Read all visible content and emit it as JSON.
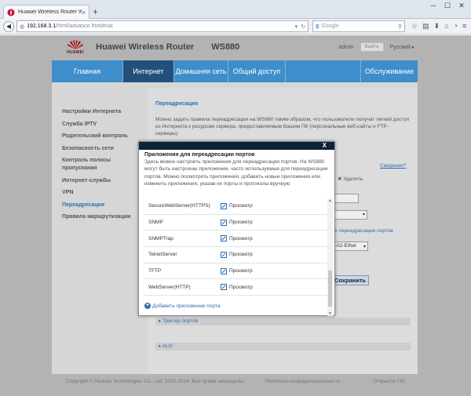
{
  "browser": {
    "tab_title": "Huawei Wireless Router W...",
    "url_host": "192.168.3.1",
    "url_path": "/html/advance.html#nat",
    "search_placeholder": "Google"
  },
  "header": {
    "brand": "Huawei Wireless Router",
    "model": "WS880",
    "logo_text": "HUAWEI",
    "user": "admin",
    "logout": "Выйти",
    "language": "Русский"
  },
  "nav": {
    "items": [
      "Главная",
      "Интернет",
      "Домашняя сеть",
      "Общий доступ",
      "Обслуживание"
    ],
    "active_index": 1
  },
  "sidebar": {
    "items": [
      "Настройки Интернета",
      "Служба IPTV",
      "Родительский контроль",
      "Безопасность сети",
      "Контроль полосы",
      "пропускания",
      "Интернет-службы",
      "VPN",
      "Переадресация",
      "Правила маршрутизации"
    ],
    "active_index": 8
  },
  "page": {
    "title": "Переадресация",
    "description": "Можно задать правила переадресации на WS880 таким образом, что пользователи получат легкий доступ из Интернета к ресурсам сервера, предоставляемым Вашим ПК (персональные веб-сайты и FTP-серверы).",
    "help_link": "Сведения?",
    "delete_label": "Удалить",
    "port_link": "е переадресации портов",
    "iface_value": "-02-Ether",
    "save_label": "Сохранить",
    "trigger_label": "Триггер портов",
    "alg_label": "ALG"
  },
  "modal": {
    "close": "X",
    "title": "Приложения для переадресации портов",
    "description": "Здесь можно настроить приложения для переадресации портов. На WS880 могут быть настроены приложения, часто используемые для переадресации портов. Можно посмотреть приложения, добавить новые приложения или изменить приложения, указав их порты и протоколы вручную",
    "view_label": "Просмотр",
    "apps": [
      "SecureWebServer(HTTPS)",
      "SNMP",
      "SNMPTrap",
      "TelnetServer",
      "TFTP",
      "WebServer(HTTP)"
    ],
    "add_label": "Добавить приложение порта"
  },
  "footer": {
    "copyright": "Copyright © Huawei Technologies Co., Ltd. 2012-2014. Все права защищены.",
    "privacy": "Политика конфиденциальности",
    "opensource": "Открытое ПО"
  },
  "colors": {
    "nav_blue": "#3d8ecb",
    "nav_active": "#23507a",
    "modal_bar": "#0f2236",
    "link": "#2d6fb0"
  }
}
